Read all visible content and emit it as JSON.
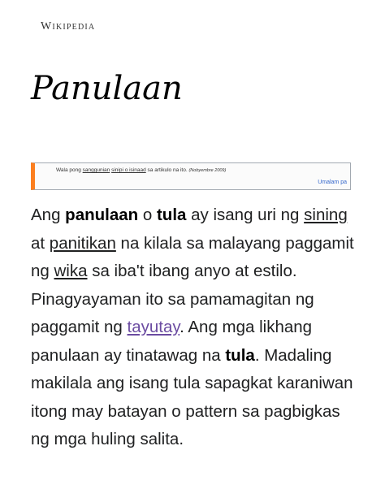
{
  "header": {
    "wordmark": "Wikipedia"
  },
  "title": "Panulaan",
  "notice": {
    "text_before": "Wala pong ",
    "link1": "sanggunian",
    "link2": "sinipi o isinaad",
    "text_after": " sa artikulo na ito. ",
    "date": "(Nobyembre 2009)",
    "more_label": "Umalam pa",
    "accent_color": "#fc7f1f"
  },
  "paragraph": {
    "t1": "Ang ",
    "panulaan": "panulaan",
    "t2": " o ",
    "tula": "tula",
    "t3": " ay isang uri ng ",
    "sining": "sining",
    "t4": " at ",
    "panitikan": "panitikan",
    "t5": " na kilala sa malayang paggamit ng ",
    "wika": "wika",
    "t6": " sa iba't ibang anyo at estilo. Pinagyayaman ito sa pamamagitan ng paggamit ng ",
    "tayutay": "tayutay",
    "t7": ". Ang mga likhang panulaan ay tinatawag na ",
    "tula2": "tula",
    "t8": ". Madaling makilala ang isang tula sapagkat karaniwan itong may batayan o pattern sa pagbigkas ng mga huling salita."
  }
}
